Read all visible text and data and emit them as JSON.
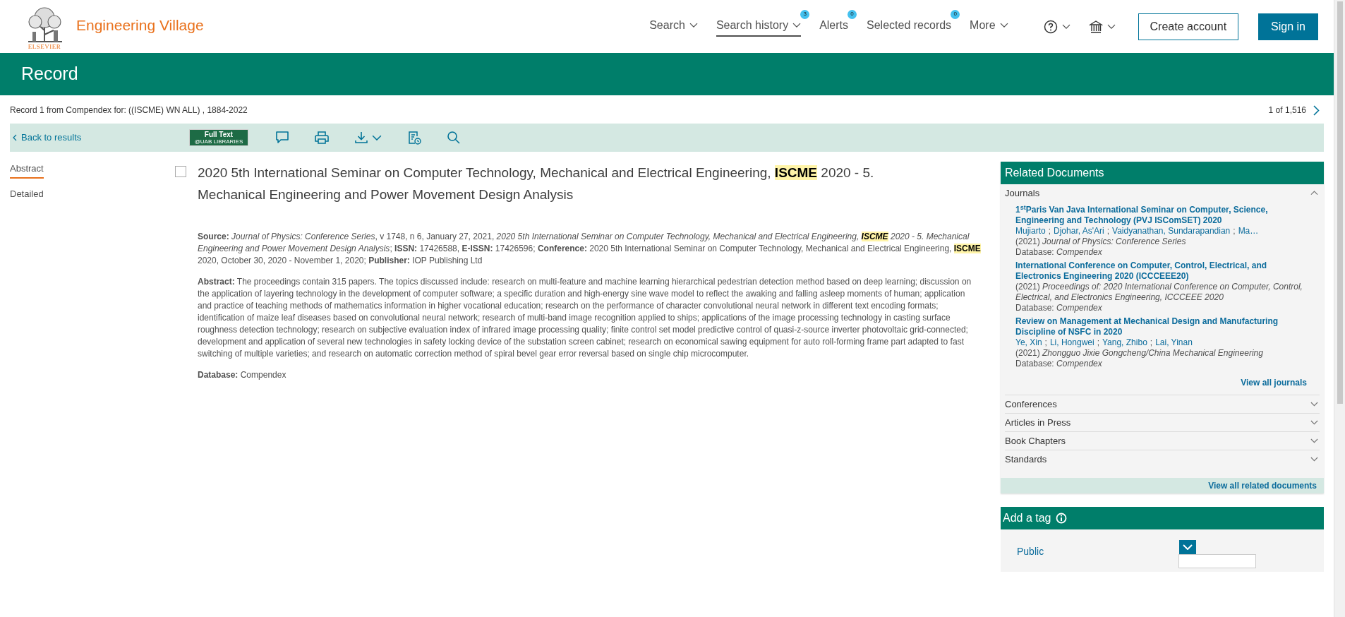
{
  "header": {
    "logo_wordmark": "ELSEVIER",
    "product": "Engineering Village",
    "nav": [
      {
        "label": "Search",
        "dropdown": true,
        "selected": false
      },
      {
        "label": "Search history",
        "dropdown": true,
        "badge": "3",
        "selected": true
      },
      {
        "label": "Alerts",
        "dropdown": false,
        "badge": "0",
        "selected": false
      },
      {
        "label": "Selected records",
        "dropdown": false,
        "badge": "0",
        "selected": false
      },
      {
        "label": "More",
        "dropdown": true,
        "selected": false
      }
    ],
    "create_account": "Create account",
    "sign_in": "Sign in"
  },
  "page_title": "Record",
  "record_info": "Record 1 from Compendex for: ((ISCME) WN ALL) , 1884-2022",
  "pager": "1 of 1,516",
  "toolbar": {
    "back": "Back to results",
    "full_text_line1": "Full Text",
    "full_text_line2": "@UAB LIBRARIES"
  },
  "side_tabs": [
    {
      "label": "Abstract",
      "selected": true
    },
    {
      "label": "Detailed",
      "selected": false
    }
  ],
  "record": {
    "checked": false,
    "title": [
      {
        "text": "2020 5th International Seminar on Computer Technology, Mechanical and Electrical Engineering, ",
        "highlighted": false
      },
      {
        "text": "ISCME",
        "highlighted": true
      },
      {
        "text": " 2020 - 5. Mechanical Engineering and Power Movement Design Analysis",
        "highlighted": false
      }
    ],
    "source": [
      {
        "text": "**Source:** *Journal of Physics: Conference Series*, v 1748, n 6, January 27, 2021, *2020 5th International Seminar on Computer Technology, Mechanical and Electrical Engineering,* ",
        "highlighted": false
      },
      {
        "text": "*ISCME*",
        "highlighted": true
      },
      {
        "text": " *2020 - 5. Mechanical Engineering and Power Movement Design Analysis*;  **ISSN:** 17426588,  **E-ISSN:** 17426596; **Conference:** 2020 5th International Seminar on Computer Technology, Mechanical and Electrical Engineering, ",
        "highlighted": false
      },
      {
        "text": "ISCME",
        "highlighted": true
      },
      {
        "text": " 2020, October 30, 2020 - November 1, 2020; **Publisher:** IOP Publishing Ltd",
        "highlighted": false
      }
    ],
    "abstract": "**Abstract:** The proceedings contain 315 papers. The topics discussed include: research on multi-feature and machine learning hierarchical pedestrian detection method based on deep learning; discussion on the application of layering technology in the development of computer software; a specific duration and high-energy sine wave model to reflect the awaking and falling asleep moments of human; application and practice of teaching methods of mathematics information in higher vocational education; research on the performance of character convolutional neural network in different text encoding formats; identification of maize leaf diseases based on convolutional neural network; research of multi-band image recognition applied to ships; applications of the image processing technology in casting surface roughness detection technology; research on subjective evaluation index of infrared image processing quality; finite control set model predictive control of quasi-z-source inverter photovoltaic grid-connected; development and application of several new technologies in safety locking device of the substation screen cabinet; research on economical sawing equipment for auto roll-forming frame part adapted to fast switching of multiple varieties; and research on automatic correction method of spiral bevel gear error reversal based on single chip microcomputer.",
    "database": "**Database:** Compendex"
  },
  "related": {
    "title": "Related Documents",
    "author_separator": ";",
    "sections": [
      {
        "label": "Journals",
        "expanded": true,
        "items": [
          {
            "title": "1$^{st}$Paris Van Java International Seminar on Computer, Science, Engineering and Technology (PVJ ISComSET) 2020",
            "authors": [
              "Mujiarto",
              "Djohar, As'Ari",
              "Vaidyanathan, Sundarapandian",
              "Ma…"
            ],
            "source": "(2021) *Journal of Physics: Conference Series*",
            "database": "Database: *Compendex*"
          },
          {
            "title": "International Conference on Computer, Control, Electrical, and Electronics Engineering 2020 (ICCCEEE20)",
            "source": "(2021) *Proceedings of: 2020 International Conference on Computer, Control, Electrical, and Electronics Engineering, ICCCEEE 2020*",
            "database": "Database: *Compendex*"
          },
          {
            "title": "Review on Management at Mechanical Design and Manufacturing Discipline of NSFC in 2020",
            "authors": [
              "Ye, Xin",
              "Li, Hongwei",
              "Yang, Zhibo",
              "Lai, Yinan"
            ],
            "source": "(2021) *Zhongguo Jixie Gongcheng/China Mechanical Engineering*",
            "database": "Database: *Compendex*"
          }
        ],
        "view_all": "View all journals"
      },
      {
        "label": "Conferences",
        "expanded": false
      },
      {
        "label": "Articles in Press",
        "expanded": false
      },
      {
        "label": "Book Chapters",
        "expanded": false
      },
      {
        "label": "Standards",
        "expanded": false
      }
    ],
    "view_all": "View all related documents"
  },
  "tag": {
    "title": "Add a tag",
    "scope": "Public"
  }
}
